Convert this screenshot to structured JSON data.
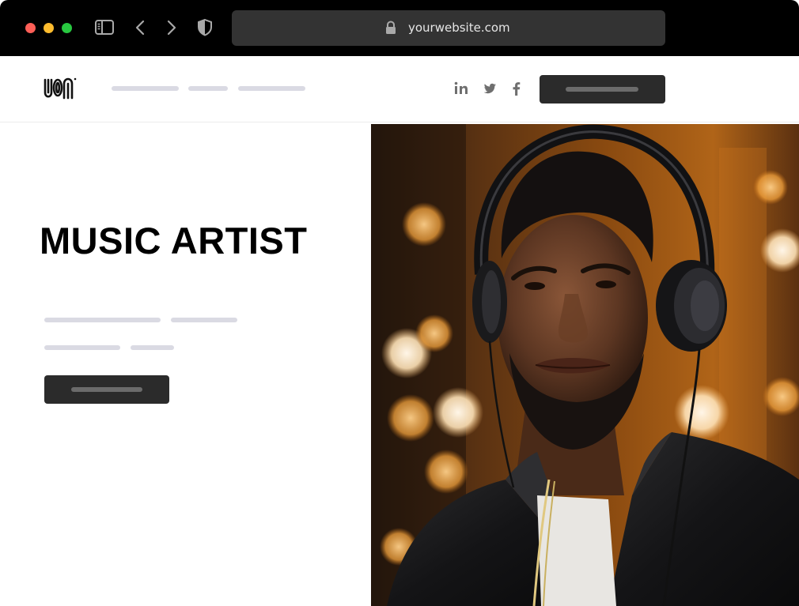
{
  "browser": {
    "url": "yourwebsite.com"
  },
  "hero": {
    "title": "MUSIC ARTIST"
  },
  "icons": {
    "window_controls": [
      "close-dot",
      "minimize-dot",
      "maximize-dot"
    ],
    "toolbar": [
      "sidebar-icon",
      "back-icon",
      "forward-icon",
      "shield-icon",
      "lock-icon"
    ],
    "social": [
      "linkedin-icon",
      "twitter-icon",
      "facebook-icon"
    ]
  },
  "colors": {
    "chrome_bg": "#000000",
    "urlbar_bg": "#333333",
    "button_bg": "#2b2b2b",
    "placeholder_line": "#dadae3",
    "title_text": "#000000"
  }
}
